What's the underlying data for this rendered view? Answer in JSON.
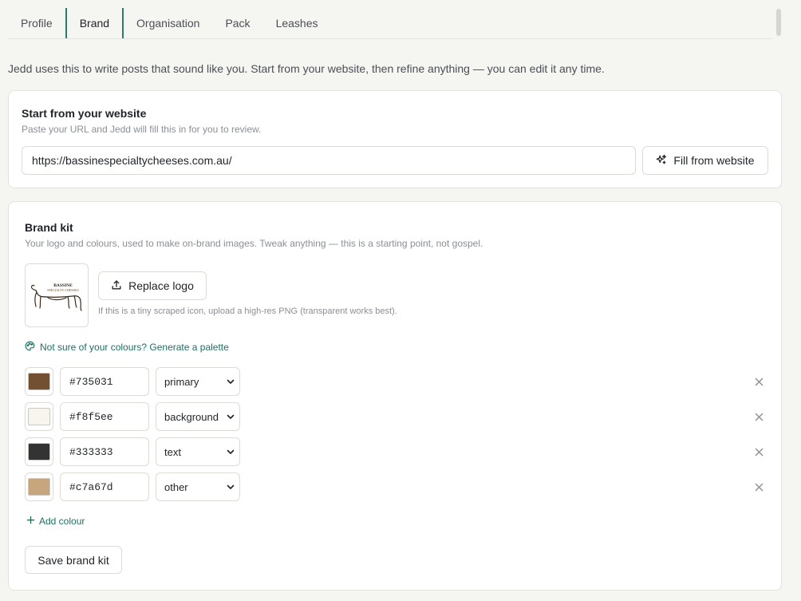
{
  "tabs": [
    {
      "label": "Profile",
      "active": false
    },
    {
      "label": "Brand",
      "active": true
    },
    {
      "label": "Organisation",
      "active": false
    },
    {
      "label": "Pack",
      "active": false
    },
    {
      "label": "Leashes",
      "active": false
    }
  ],
  "intro": "Jedd uses this to write posts that sound like you. Start from your website, then refine anything — you can edit it any time.",
  "website": {
    "title": "Start from your website",
    "subtitle": "Paste your URL and Jedd will fill this in for you to review.",
    "url_value": "https://bassinespecialtycheeses.com.au/",
    "fill_button": "Fill from website",
    "fill_icon": "sparkles-icon"
  },
  "brand_kit": {
    "title": "Brand kit",
    "subtitle": "Your logo and colours, used to make on-brand images. Tweak anything — this is a starting point, not gospel.",
    "logo_alt": "Bassine Specialty Cheeses logo",
    "logo_text": "BASSINE SPECIALTY CHEESES",
    "replace_button": "Replace logo",
    "replace_icon": "upload-icon",
    "logo_hint": "If this is a tiny scraped icon, upload a high-res PNG (transparent works best).",
    "palette_link": "Not sure of your colours? Generate a palette",
    "palette_icon": "palette-icon",
    "colours": [
      {
        "hex": "#735031",
        "role": "primary"
      },
      {
        "hex": "#f8f5ee",
        "role": "background"
      },
      {
        "hex": "#333333",
        "role": "text"
      },
      {
        "hex": "#c7a67d",
        "role": "other"
      }
    ],
    "add_colour": "Add colour",
    "save_button": "Save brand kit"
  },
  "theme": {
    "accent": "#2d7a6d",
    "link": "#1f6f62",
    "page_bg": "#f5f5f2",
    "card_bg": "#ffffff"
  }
}
